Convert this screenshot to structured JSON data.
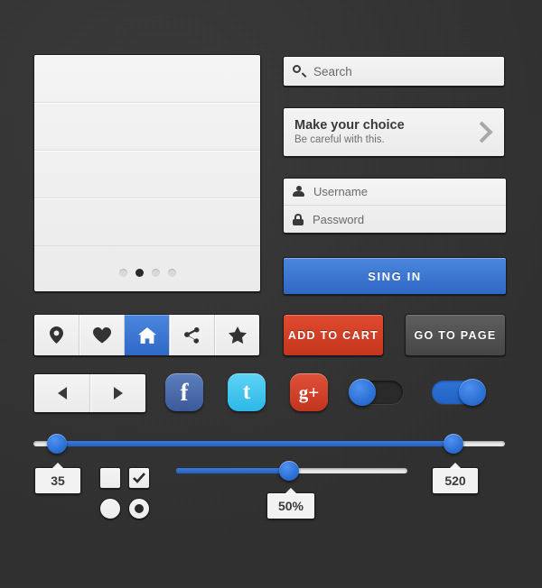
{
  "theme": {
    "background": "#323232",
    "accent_blue": "#2f68c6",
    "panel_light": "#ededed",
    "cart_red": "#c3361d",
    "dark_button": "#4a4a4a",
    "facebook_blue": "#3b5998",
    "twitter_blue": "#2cb8e8",
    "googleplus_red": "#c3341f"
  },
  "list_panel": {
    "rows": [
      "",
      "",
      "",
      "",
      ""
    ],
    "pagination": {
      "dots": 4,
      "active_index": 1
    }
  },
  "search": {
    "icon": "search-icon",
    "placeholder": "Search",
    "value": ""
  },
  "choice_card": {
    "title": "Make your choice",
    "subtitle": "Be careful with this.",
    "accessory_icon": "chevron-right-icon"
  },
  "login": {
    "username": {
      "icon": "user-icon",
      "placeholder": "Username",
      "value": ""
    },
    "password": {
      "icon": "lock-icon",
      "placeholder": "Password",
      "value": ""
    },
    "submit_label": "SING IN"
  },
  "icon_toolbar": {
    "items": [
      {
        "icon": "map-pin-icon",
        "active": false
      },
      {
        "icon": "heart-icon",
        "active": false
      },
      {
        "icon": "home-icon",
        "active": true
      },
      {
        "icon": "share-icon",
        "active": false
      },
      {
        "icon": "star-icon",
        "active": false
      }
    ]
  },
  "actions": {
    "add_to_cart_label": "ADD TO CART",
    "go_to_page_label": "GO TO PAGE"
  },
  "pager": {
    "prev_icon": "arrow-left-icon",
    "next_icon": "arrow-right-icon"
  },
  "social": {
    "facebook": {
      "icon": "facebook-icon",
      "glyph": "f"
    },
    "twitter": {
      "icon": "twitter-icon",
      "glyph": "t"
    },
    "googleplus": {
      "icon": "google-plus-icon",
      "glyph": "g+"
    }
  },
  "toggles": [
    {
      "name": "toggle-off",
      "state": "off"
    },
    {
      "name": "toggle-on",
      "state": "on"
    }
  ],
  "range_slider": {
    "min_value": "35",
    "max_value": "520",
    "min_percent": 5,
    "max_percent": 89
  },
  "mid_slider": {
    "value": "50%",
    "percent": 49
  },
  "choices": {
    "checkbox_unchecked": "unchecked",
    "checkbox_checked": "checked",
    "radio_unselected": "unselected",
    "radio_selected": "selected"
  }
}
